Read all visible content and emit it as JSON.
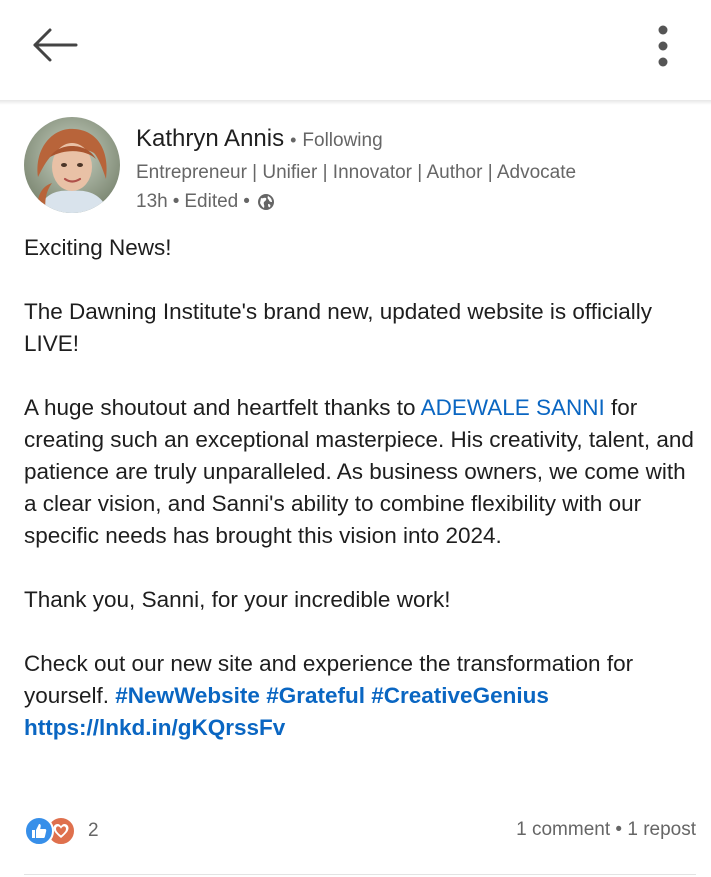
{
  "topbar": {
    "back_icon": "arrow-left-icon",
    "more_icon": "vertical-dots-icon"
  },
  "author": {
    "name": "Kathryn Annis",
    "separator": "•",
    "follow_status": "Following",
    "headline": "Entrepreneur | Unifier | Innovator | Author | Advocate",
    "time": "13h",
    "edited": "Edited",
    "visibility_icon": "globe-icon"
  },
  "post": {
    "p1": "Exciting News!",
    "p2": "The Dawning Institute's brand new, updated website is officially LIVE!",
    "p3_before": "A huge shoutout and heartfelt thanks to ",
    "p3_mention": "ADEWALE SANNI",
    "p3_after": " for creating such an exceptional masterpiece. His creativity, talent, and patience are truly unparalleled. As business owners, we come with a clear vision, and Sanni's ability to combine flexibility with our specific needs has brought this vision into 2024.",
    "p4": "Thank you, Sanni, for your incredible work!",
    "p5_text": "Check out our new site and experience the transformation for yourself. ",
    "hashtags": [
      "#NewWebsite",
      "#Grateful",
      "#CreativeGenius"
    ],
    "link": "https://lnkd.in/gKQrssFv"
  },
  "social": {
    "reaction_count": "2",
    "reaction_icons": [
      "like-icon",
      "love-icon"
    ],
    "comments": "1 comment",
    "separator": "•",
    "reposts": "1 repost"
  },
  "colors": {
    "link": "#0a66c2",
    "like": "#378fe9",
    "love": "#df704d",
    "secondary_text": "#666666"
  }
}
